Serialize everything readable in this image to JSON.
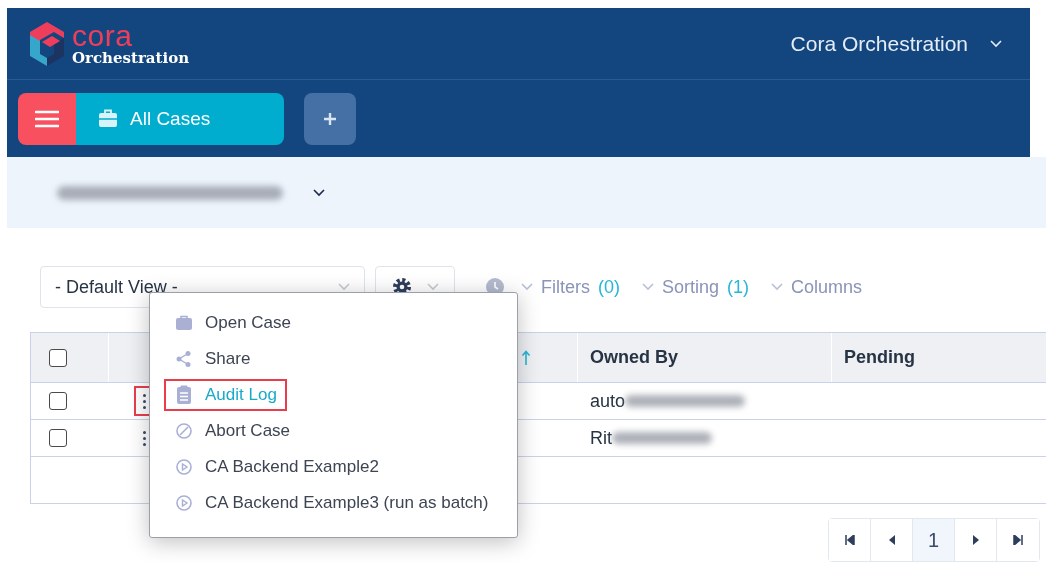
{
  "header": {
    "logo": {
      "word": "cora",
      "subtitle": "Orchestration"
    },
    "workspace": "Cora Orchestration"
  },
  "nav": {
    "tab": "All Cases"
  },
  "toolbar": {
    "view": "- Default View -",
    "filters": {
      "label": "Filters",
      "count": "(0)"
    },
    "sorting": {
      "label": "Sorting",
      "count": "(1)"
    },
    "columns": "Columns"
  },
  "table": {
    "header_checked": false,
    "columns": [
      {
        "label": "Owned By"
      },
      {
        "label": "Pending"
      }
    ],
    "rows": [
      {
        "checked": false,
        "highlighted": true,
        "owner": "auto"
      },
      {
        "checked": false,
        "highlighted": false,
        "owner": "Rit"
      }
    ]
  },
  "context_menu": {
    "items": [
      {
        "kind": "open",
        "label": "Open Case",
        "highlighted": false
      },
      {
        "kind": "share",
        "label": "Share",
        "highlighted": false
      },
      {
        "kind": "log",
        "label": "Audit Log",
        "highlighted": true
      },
      {
        "kind": "abort",
        "label": "Abort Case",
        "highlighted": false
      },
      {
        "kind": "action",
        "label": "CA Backend Example2",
        "highlighted": false
      },
      {
        "kind": "action",
        "label": "CA Backend Example3 (run as batch)",
        "highlighted": false
      }
    ]
  },
  "pagination": {
    "page": "1"
  }
}
